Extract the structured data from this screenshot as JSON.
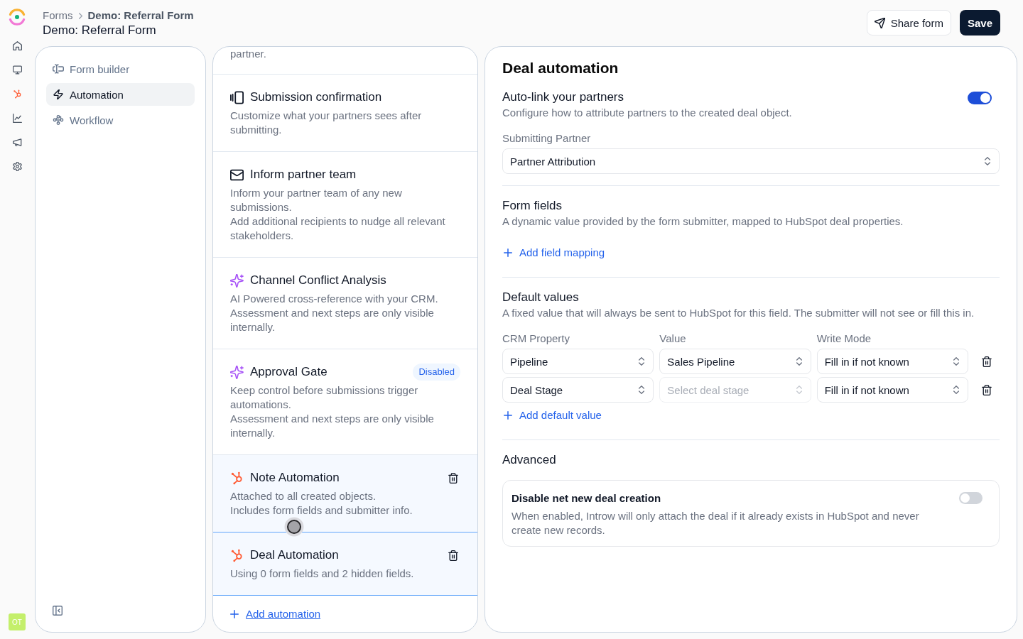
{
  "rail": {
    "avatar": "OT"
  },
  "header": {
    "breadcrumb": [
      "Forms",
      "Demo: Referral Form"
    ],
    "title": "Demo: Referral Form",
    "buttons": [
      {
        "label": "Share form",
        "kind": "secondary"
      },
      {
        "label": "Save",
        "kind": "primary"
      }
    ]
  },
  "sidebar": {
    "items": [
      {
        "label": "Form builder",
        "selected": false
      },
      {
        "label": "Automation",
        "selected": true
      },
      {
        "label": "Workflow",
        "selected": false
      }
    ]
  },
  "automations": {
    "partial_text": "partner.",
    "items": [
      {
        "kind": "confirmation",
        "title": "Submission confirmation",
        "description": "Customize what your partners sees after submitting.",
        "selected": false
      },
      {
        "kind": "notification",
        "title": "Inform partner team",
        "description": "Inform your partner team of any new submissions.\nAdd additional recipients to nudge all relevant stakeholders.",
        "selected": false
      },
      {
        "kind": "ai",
        "title": "Channel Conflict Analysis",
        "description": "AI Powered cross-reference with your CRM.\nAssessment and next steps are only visible internally.",
        "selected": false
      },
      {
        "kind": "ai",
        "title": "Approval Gate",
        "badge": "Disabled",
        "description": "Keep control before submissions trigger automations.\nAssessment and next steps are only visible internally.",
        "selected": false
      },
      {
        "kind": "crm",
        "title": "Note Automation",
        "description": "Attached to all created objects.\nIncludes form fields and submitter info.",
        "selected": true
      },
      {
        "kind": "crm",
        "title": "Deal Automation",
        "description": "Using 0 form fields and 2 hidden fields.",
        "selected": true
      }
    ],
    "add_link": "Add automation"
  },
  "deal_automation": {
    "title": "Deal automation",
    "auto_link": {
      "title": "Auto-link your partners",
      "description": "Configure how to attribute partners to the created deal object.",
      "on": true
    },
    "submitting_partner": {
      "label": "Submitting Partner",
      "value": "Partner Attribution"
    },
    "form_fields": {
      "title": "Form fields",
      "description": "A dynamic value provided by the form submitter, mapped to HubSpot deal properties.",
      "add_link": "Add field mapping"
    },
    "default_values": {
      "title": "Default values",
      "description": "A fixed value that will always be sent to HubSpot for this field. The submitter will not see or fill this in.",
      "columns": [
        "CRM Property",
        "Value",
        "Write Mode"
      ],
      "rows": [
        {
          "crm_property": "Pipeline",
          "value": {
            "value": "Sales Pipeline",
            "disabled": false
          },
          "write_mode": "Fill in if not known"
        },
        {
          "crm_property": "Deal Stage",
          "value": {
            "placeholder": "Select deal stage",
            "disabled": true
          },
          "write_mode": "Fill in if not known"
        }
      ],
      "add_link": "Add default value"
    },
    "advanced": {
      "title": "Advanced",
      "option": {
        "title": "Disable net new deal creation",
        "description": "When enabled, Introw will only attach the deal if it already exists in HubSpot and never create new records.",
        "on": false
      }
    }
  }
}
